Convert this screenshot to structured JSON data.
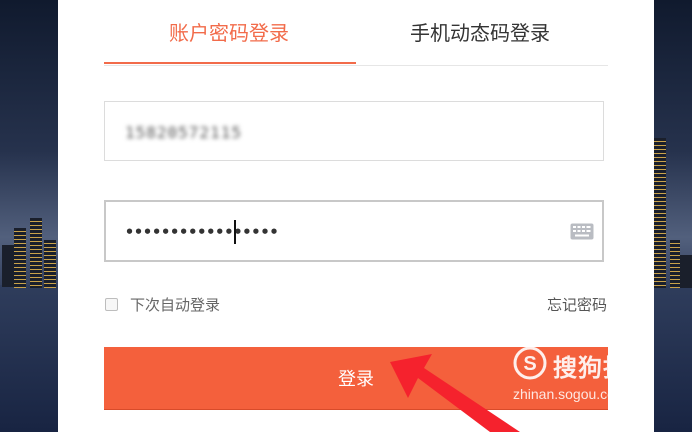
{
  "tabs": [
    {
      "label": "账户密码登录",
      "active": true
    },
    {
      "label": "手机动态码登录",
      "active": false
    }
  ],
  "username": {
    "value": "15820572115",
    "blurred": true
  },
  "password": {
    "value": "•••••••••••••••••"
  },
  "remember": {
    "label": "下次自动登录",
    "checked": false
  },
  "forgot_label": "忘记密码",
  "login_label": "登录",
  "watermark": {
    "brand": "搜狗指南",
    "url": "zhinan.sogou.com"
  },
  "colors": {
    "accent": "#f26b4a",
    "button": "#f4603c",
    "arrow": "#f5222d"
  },
  "icons": {
    "keyboard": "keyboard-icon",
    "logo": "sogou-logo-icon"
  }
}
